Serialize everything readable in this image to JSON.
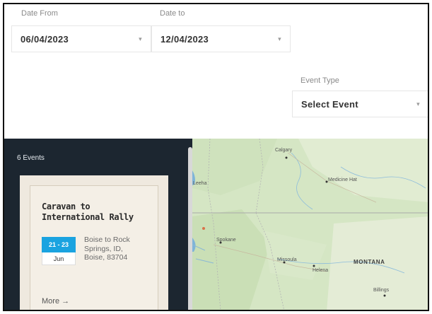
{
  "filters": {
    "date_from": {
      "label": "Date From",
      "value": "06/04/2023"
    },
    "date_to": {
      "label": "Date to",
      "value": "12/04/2023"
    },
    "event_type": {
      "label": "Event Type",
      "value": "Select Event"
    }
  },
  "events_panel": {
    "count_label": "6 Events",
    "cards": [
      {
        "title": "Caravan to International Rally",
        "date_range": "21 - 23",
        "month": "Jun",
        "address": "Boise to Rock Springs, ID, Boise, 83704",
        "more_label": "More →"
      }
    ]
  },
  "map": {
    "labels": {
      "calgary": "Calgary",
      "medicine_hat": "Medicine Hat",
      "spokane": "Spokane",
      "missoula": "Missoula",
      "helena": "Helena",
      "montana": "MONTANA",
      "billings": "Billings",
      "edge_left": "Leeha"
    },
    "colors": {
      "land": "#d7e7c7",
      "water": "#7fb4d8",
      "border": "#a9a9a9",
      "accent": "#1aa3e0"
    }
  }
}
